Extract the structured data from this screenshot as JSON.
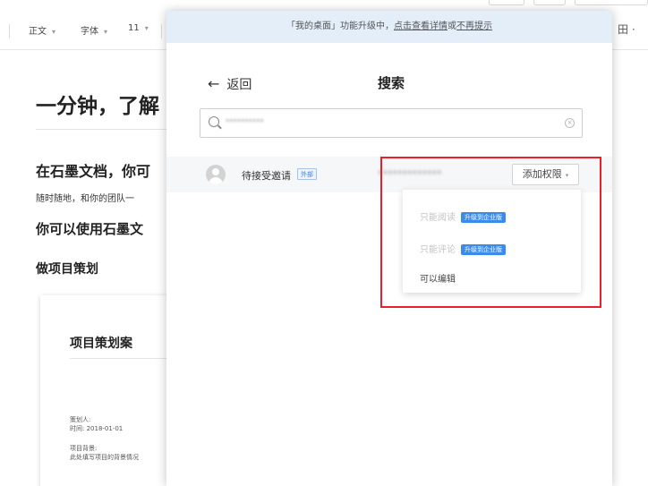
{
  "toolbar": {
    "style": "正文",
    "font": "字体",
    "size": "11",
    "right_icon": "田 ·"
  },
  "document": {
    "title": "一分钟，了解",
    "heading1": "在石墨文档，你可",
    "paragraph": "随时随地，和你的团队一",
    "heading2": "你可以使用石墨文",
    "heading3": "做项目策划",
    "card": {
      "title": "项目策划案",
      "line1": "策划人:",
      "line2": "时间: 2018-01-01",
      "line3": "项目背景:",
      "line4": "此处填写项目的背景情况"
    }
  },
  "dialog": {
    "banner": {
      "prefix": "「我的桌面」功能升级中，",
      "link_details": "点击查看详情",
      "link_sep": "或",
      "link_dismiss": "不再提示"
    },
    "back_label": "返回",
    "title": "搜索",
    "search": {
      "value": "**********"
    },
    "user": {
      "name": "待接受邀请",
      "badge": "外部",
      "email": "*************",
      "permission_button": "添加权限"
    },
    "dropdown": {
      "items": [
        {
          "label": "只能阅读",
          "badge": "升级到企业版",
          "disabled": true
        },
        {
          "label": "只能评论",
          "badge": "升级到企业版",
          "disabled": true
        },
        {
          "label": "可以编辑",
          "badge": "",
          "disabled": false
        }
      ]
    }
  },
  "colors": {
    "banner_bg": "#e3eef9",
    "upgrade_badge": "#3b8beb",
    "highlight_border": "#e8202a",
    "external_badge": "#3f7fd8"
  }
}
